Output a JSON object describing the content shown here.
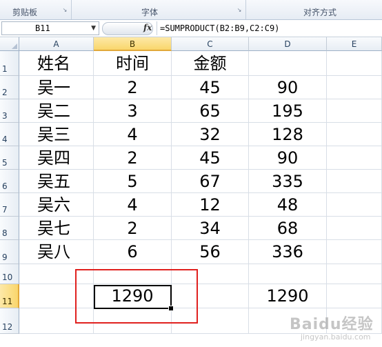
{
  "ribbon": {
    "groups": [
      {
        "label": "剪贴板"
      },
      {
        "label": "字体"
      },
      {
        "label": "对齐方式"
      }
    ],
    "launcher_glyph": "↘"
  },
  "formula_bar": {
    "name_box": "B11",
    "fx_label": "fx",
    "formula": "=SUMPRODUCT(B2:B9,C2:C9)"
  },
  "sheet": {
    "columns": [
      "A",
      "B",
      "C",
      "D",
      "E"
    ],
    "rows": [
      "1",
      "2",
      "3",
      "4",
      "5",
      "6",
      "7",
      "8",
      "9",
      "10",
      "11",
      "12"
    ],
    "selected_column": "B",
    "selected_row": "11",
    "cells": {
      "A1": "姓名",
      "B1": "时间",
      "C1": "金额",
      "D1": "",
      "A2": "吴一",
      "B2": "2",
      "C2": "45",
      "D2": "90",
      "A3": "吴二",
      "B3": "3",
      "C3": "65",
      "D3": "195",
      "A4": "吴三",
      "B4": "4",
      "C4": "32",
      "D4": "128",
      "A5": "吴四",
      "B5": "2",
      "C5": "45",
      "D5": "90",
      "A6": "吴五",
      "B6": "5",
      "C6": "67",
      "D6": "335",
      "A7": "吴六",
      "B7": "4",
      "C7": "12",
      "D7": "48",
      "A8": "吴七",
      "B8": "2",
      "C8": "34",
      "D8": "68",
      "A9": "吴八",
      "B9": "6",
      "C9": "56",
      "D9": "336",
      "B11": "1290",
      "D11": "1290"
    }
  },
  "annotation": {
    "color": "#e0201e"
  },
  "watermark": {
    "text": "Baidu经验",
    "sub": "jingyan.baidu.com"
  }
}
